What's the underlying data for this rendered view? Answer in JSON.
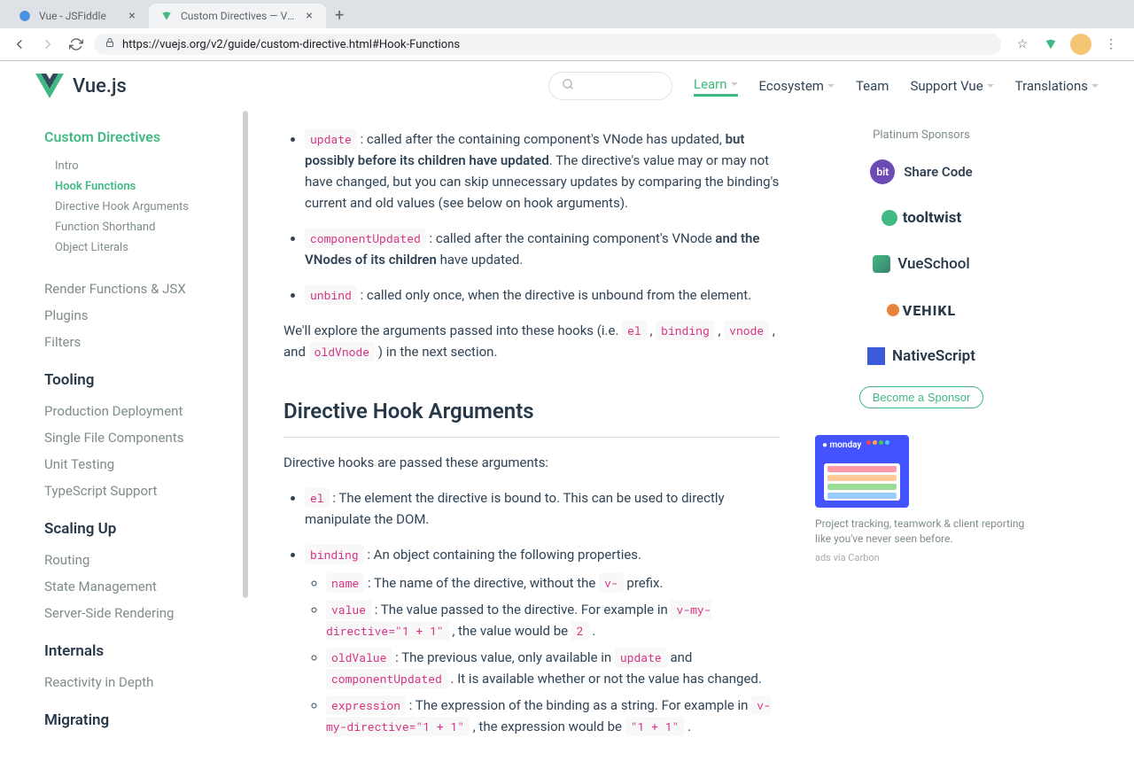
{
  "browser": {
    "tabs": [
      {
        "title": "Vue - JSFiddle",
        "active": false
      },
      {
        "title": "Custom Directives — Vue.js",
        "active": true
      }
    ],
    "url": "https://vuejs.org/v2/guide/custom-directive.html#Hook-Functions"
  },
  "header": {
    "logo_text": "Vue.js",
    "nav": [
      "Learn",
      "Ecosystem",
      "Team",
      "Support Vue",
      "Translations"
    ]
  },
  "sidebar": {
    "title": "Custom Directives",
    "sub_items": [
      "Intro",
      "Hook Functions",
      "Directive Hook Arguments",
      "Function Shorthand",
      "Object Literals"
    ],
    "active_sub": "Hook Functions",
    "items1": [
      "Render Functions & JSX",
      "Plugins",
      "Filters"
    ],
    "heading1": "Tooling",
    "items2": [
      "Production Deployment",
      "Single File Components",
      "Unit Testing",
      "TypeScript Support"
    ],
    "heading2": "Scaling Up",
    "items3": [
      "Routing",
      "State Management",
      "Server-Side Rendering"
    ],
    "heading3": "Internals",
    "items4": [
      "Reactivity in Depth"
    ],
    "heading4": "Migrating"
  },
  "content": {
    "hooks": {
      "update": {
        "code": "update",
        "text1": " : called after the containing component's VNode has updated, ",
        "bold1": "but possibly before its children have updated",
        "text2": ". The directive's value may or may not have changed, but you can skip unnecessary updates by comparing the binding's current and old values (see below on hook arguments)."
      },
      "componentUpdated": {
        "code": "componentUpdated",
        "text1": " : called after the containing component's VNode ",
        "bold1": "and the VNodes of its children",
        "text2": " have updated."
      },
      "unbind": {
        "code": "unbind",
        "text1": " : called only once, when the directive is unbound from the element."
      }
    },
    "explore_text1": "We'll explore the arguments passed into these hooks (i.e. ",
    "explore_codes": [
      "el",
      "binding",
      "vnode",
      "oldVnode"
    ],
    "explore_text2": " ) in the next section.",
    "h2": "Directive Hook Arguments",
    "args_intro": "Directive hooks are passed these arguments:",
    "args": {
      "el": {
        "code": "el",
        "text": " : The element the directive is bound to. This can be used to directly manipulate the DOM."
      },
      "binding": {
        "code": "binding",
        "text": " : An object containing the following properties.",
        "props": {
          "name": {
            "code": "name",
            "text1": " : The name of the directive, without the ",
            "code2": "v-",
            "text2": " prefix."
          },
          "value": {
            "code": "value",
            "text1": " : The value passed to the directive. For example in ",
            "code2": "v-my-directive=\"1 + 1\"",
            "text2": " , the value would be ",
            "code3": "2",
            "text3": " ."
          },
          "oldValue": {
            "code": "oldValue",
            "text1": " : The previous value, only available in ",
            "code2": "update",
            "text2": " and ",
            "code3": "componentUpdated",
            "text3": " . It is available whether or not the value has changed."
          },
          "expression": {
            "code": "expression",
            "text1": " : The expression of the binding as a string. For example in ",
            "code2": "v-my-directive=\"1 + 1\"",
            "text2": " , the expression would be ",
            "code3": "\"1 + 1\"",
            "text3": " ."
          }
        }
      }
    }
  },
  "sponsors": {
    "label": "Platinum Sponsors",
    "bit": "Share Code",
    "tooltwist": "tooltwist",
    "vueschool": "VueSchool",
    "vehikl": "VEHIKL",
    "nativescript": "NativeScript",
    "become": "Become a Sponsor",
    "ad_brand": "monday",
    "ad_text": "Project tracking, teamwork & client reporting like you've never seen before.",
    "ad_via": "ads via Carbon"
  }
}
